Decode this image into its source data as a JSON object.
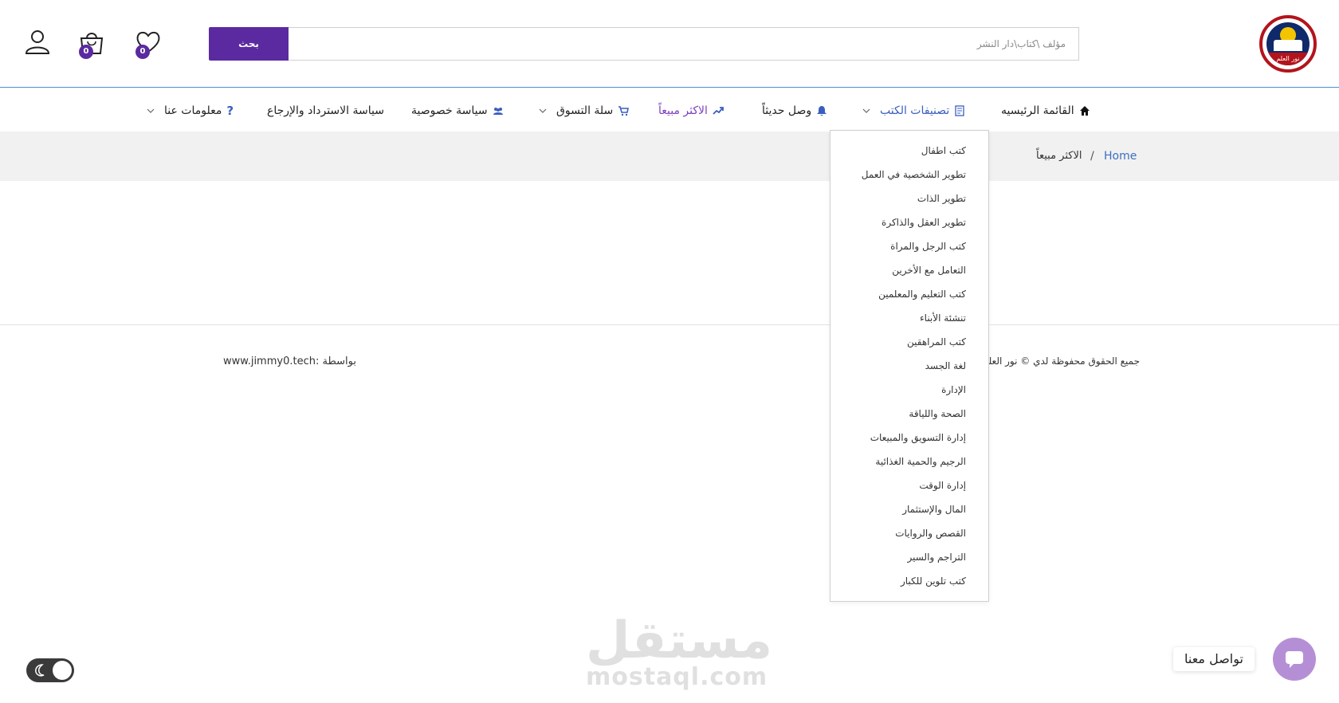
{
  "header": {
    "logo_text": "نور العلم",
    "search": {
      "placeholder": "مؤلف \\كتاب\\دار النشر",
      "button_label": "بحث"
    },
    "cart_count": "0",
    "wishlist_count": "0"
  },
  "nav": {
    "items": [
      {
        "label": "القائمة الرئيسيه",
        "icon": "home-icon"
      },
      {
        "label": "تصنيفات الكتب",
        "icon": "book-icon"
      },
      {
        "label": "وصل حديثاً",
        "icon": "bell-icon"
      },
      {
        "label": "الاكثر مبيعاً",
        "icon": "trend-up-icon"
      },
      {
        "label": "سلة التسوق",
        "icon": "cart-icon"
      },
      {
        "label": "سياسة خصوصية",
        "icon": "users-icon"
      },
      {
        "label": "سياسة الاسترداد والإرجاع"
      },
      {
        "label": "معلومات عنا",
        "icon": "question-icon"
      }
    ]
  },
  "breadcrumb": {
    "home": "Home",
    "separator": "/",
    "current": "الاكثر مبيعاً"
  },
  "dropdown": {
    "items": [
      "كتب اطفال",
      "تطوير الشخصية في العمل",
      "تطوير الذات",
      "تطوير العقل والذاكرة",
      "كتب الرجل والمراة",
      "التعامل مع الأخرين",
      "كتب التعليم والمعلمين",
      "تنشئة الأبناء",
      "كتب المراهقين",
      "لغة الجسد",
      "الإدارة",
      "الصحة واللياقة",
      "إدارة التسويق والمبيعات",
      "الرجيم والحمية الغذائية",
      "إدارة الوقت",
      "المال والإستثمار",
      "القصص والروايات",
      "التراجم والسير",
      "كتب تلوين للكبار"
    ]
  },
  "footer": {
    "copyright": "جميع الحقوق محفوظة لدي © نور العلم",
    "credits": "www.jimmy0.tech: بواسطة"
  },
  "watermark": {
    "arabic": "مستقل",
    "latin": "mostaql.com"
  },
  "chat": {
    "label": "تواصل معنا"
  },
  "colors": {
    "accent": "#5b2aa0",
    "link": "#3b6fc0",
    "active": "#7b3fbf",
    "chat": "#b58fd6",
    "logo_red": "#b3141c"
  }
}
